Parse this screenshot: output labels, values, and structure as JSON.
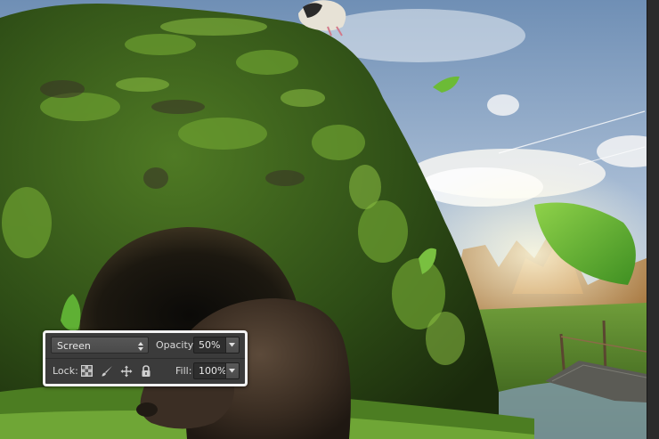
{
  "layers_panel": {
    "blend_mode": {
      "value": "Screen",
      "icon": "updown-arrows-icon"
    },
    "opacity": {
      "label": "Opacity:",
      "value": "50%",
      "icon": "chevron-down-icon"
    },
    "lock": {
      "label": "Lock:",
      "icons": [
        "lock-transparent-pixels-icon",
        "lock-image-pixels-brush-icon",
        "lock-position-move-icon",
        "lock-all-padlock-icon"
      ]
    },
    "fill": {
      "label": "Fill:",
      "value": "100%",
      "icon": "chevron-down-icon"
    }
  },
  "colors": {
    "panel_bg": "#3b3b3b",
    "panel_border": "#f2f2f2",
    "field_bg": "#2e2e2e",
    "text": "#e6e6e6"
  }
}
